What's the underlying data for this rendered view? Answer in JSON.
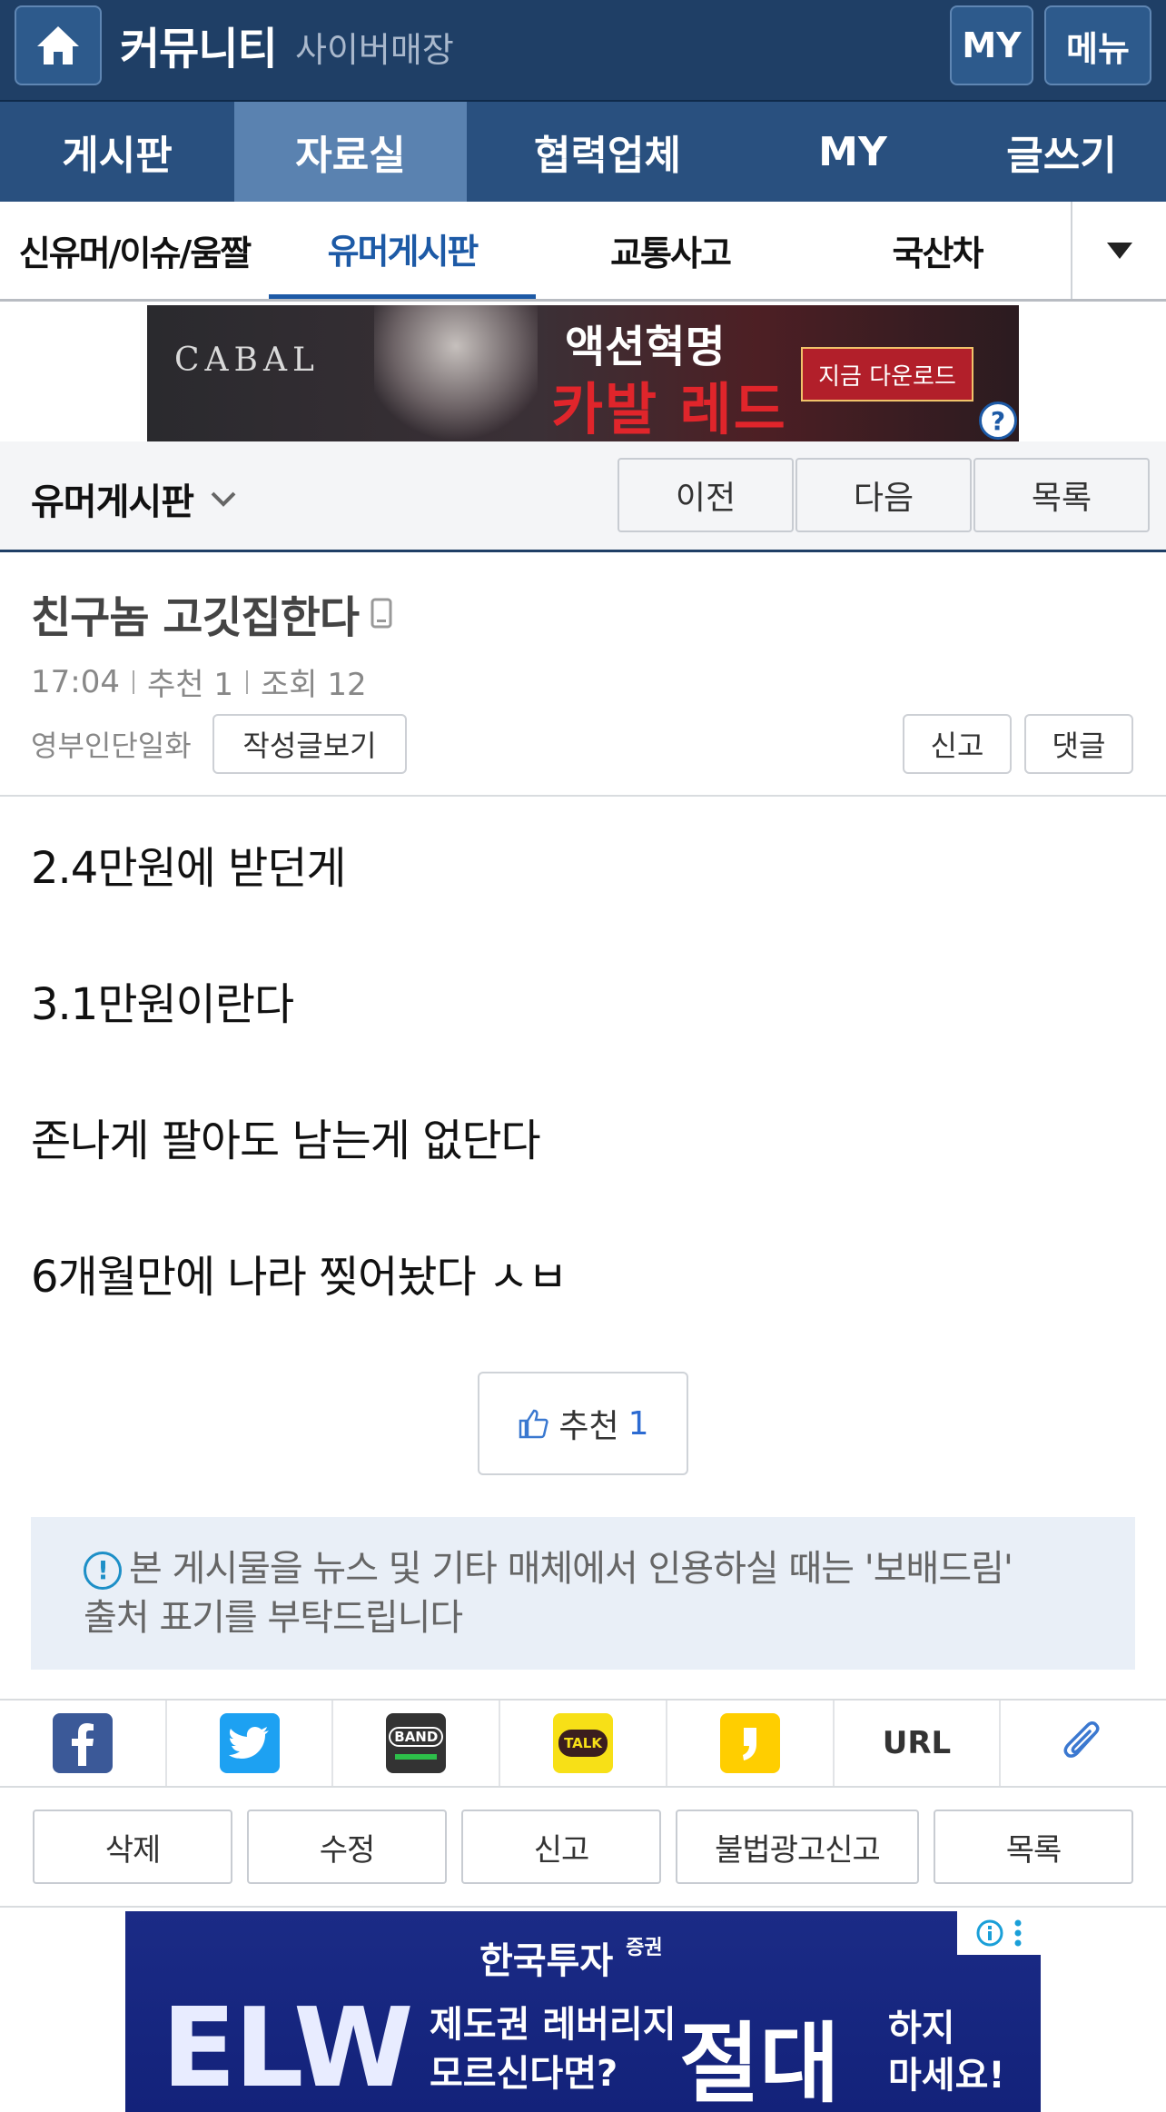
{
  "header": {
    "brand": "커뮤니티",
    "sub": "사이버매장",
    "my_label": "MY",
    "menu_label": "메뉴"
  },
  "main_nav": [
    {
      "label": "게시판"
    },
    {
      "label": "자료실"
    },
    {
      "label": "협력업체"
    },
    {
      "label": "MY"
    },
    {
      "label": "글쓰기"
    }
  ],
  "sub_nav": [
    {
      "label": "신유머/이슈/움짤"
    },
    {
      "label": "유머게시판"
    },
    {
      "label": "교통사고"
    },
    {
      "label": "국산차"
    }
  ],
  "ad_top": {
    "brand": "CABAL",
    "headline": "액션혁명",
    "game": "카발 레드",
    "cta": "지금 다운로드"
  },
  "board": {
    "title": "유머게시판",
    "prev": "이전",
    "next": "다음",
    "list": "목록"
  },
  "post": {
    "title": "친구놈 고깃집한다",
    "time": "17:04",
    "recommend": "추천 1",
    "views": "조회 12",
    "author": "영부인단일화",
    "view_posts": "작성글보기",
    "report": "신고",
    "comment": "댓글",
    "body": [
      "2.4만원에 받던게",
      "3.1만원이란다",
      "존나게 팔아도 남는게 없단다",
      "6개월만에 나라 찢어놨다 ㅅㅂ"
    ],
    "like_label": "추천",
    "like_count": "1"
  },
  "notice": {
    "line1": "본 게시물을 뉴스 및 기타 매체에서 인용하실 때는 '보배드림'",
    "line2": "출처 표기를 부탁드립니다"
  },
  "share": {
    "band": "BAND",
    "talk": "TALK",
    "url": "URL"
  },
  "actions": {
    "delete": "삭제",
    "edit": "수정",
    "report": "신고",
    "illegal_ad": "불법광고신고",
    "list": "목록"
  },
  "ad_bottom": {
    "company": "한국투자",
    "company_suffix": "증권",
    "elw": "ELW",
    "line1": "제도권 레버리지",
    "line2": "모르신다면?",
    "big": "절대",
    "end1": "하지",
    "end2": "마세요!"
  },
  "colors": {
    "header": "#1f3f66",
    "nav": "#29507f",
    "nav_active": "#5a82b0",
    "accent": "#1d5aa6"
  }
}
